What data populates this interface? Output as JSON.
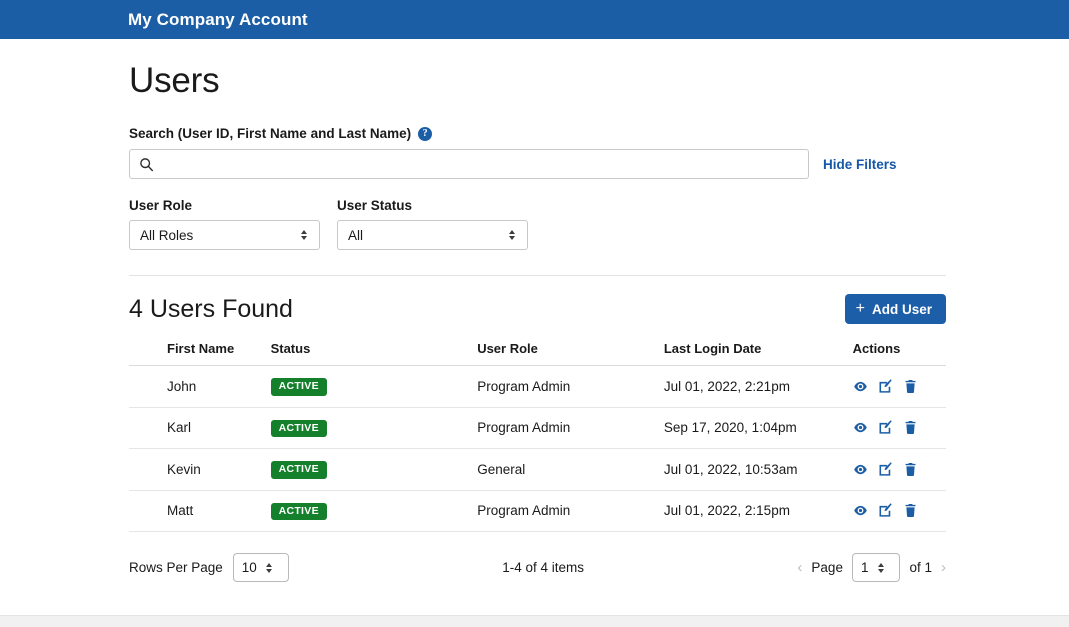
{
  "topbar": {
    "title": "My Company Account"
  },
  "page": {
    "title": "Users"
  },
  "search": {
    "label": "Search (User ID, First Name and Last Name)",
    "help_icon": "help-circle-icon",
    "search_icon": "search-icon",
    "value": "",
    "placeholder": "",
    "hide_filters_label": "Hide Filters"
  },
  "filters": {
    "user_role": {
      "label": "User Role",
      "value": "All Roles"
    },
    "user_status": {
      "label": "User Status",
      "value": "All"
    }
  },
  "results": {
    "count_label": "4 Users Found",
    "add_user_label": "Add User",
    "add_icon": "plus-icon"
  },
  "table": {
    "columns": [
      "First Name",
      "Status",
      "User Role",
      "Last Login Date",
      "Actions"
    ],
    "rows": [
      {
        "first_name": "John",
        "status": "ACTIVE",
        "role": "Program Admin",
        "last_login": "Jul 01, 2022, 2:21pm"
      },
      {
        "first_name": "Karl",
        "status": "ACTIVE",
        "role": "Program Admin",
        "last_login": "Sep 17, 2020, 1:04pm"
      },
      {
        "first_name": "Kevin",
        "status": "ACTIVE",
        "role": "General",
        "last_login": "Jul 01, 2022, 10:53am"
      },
      {
        "first_name": "Matt",
        "status": "ACTIVE",
        "role": "Program Admin",
        "last_login": "Jul 01, 2022, 2:15pm"
      }
    ],
    "action_icons": [
      "view-eye-icon",
      "edit-pencil-icon",
      "delete-trash-icon"
    ]
  },
  "pagination": {
    "rows_per_page_label": "Rows Per Page",
    "rows_per_page_value": "10",
    "items_label": "1-4 of 4 items",
    "prev_icon": "chevron-left-icon",
    "page_label": "Page",
    "page_value": "1",
    "of_label": "of 1",
    "next_icon": "chevron-right-icon"
  },
  "colors": {
    "header_blue": "#1b5ea6",
    "link_blue": "#1558a8",
    "button_blue": "#1c5ea8",
    "badge_green": "#15802b",
    "icon_blue": "#1b5ea6"
  }
}
